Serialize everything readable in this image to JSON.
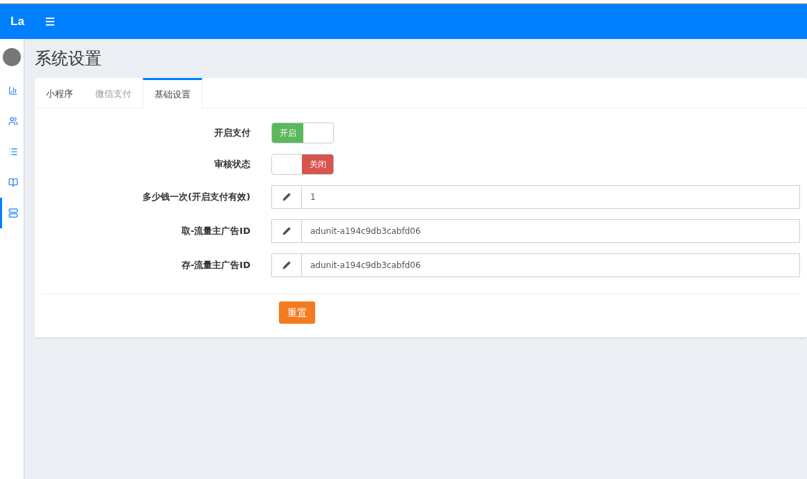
{
  "header": {
    "logo": "La"
  },
  "sidebar": {
    "items": [
      {
        "kind": "chart",
        "selected": false
      },
      {
        "kind": "users",
        "selected": false
      },
      {
        "kind": "list",
        "selected": false
      },
      {
        "kind": "book",
        "selected": false
      },
      {
        "kind": "server",
        "selected": true
      }
    ]
  },
  "page_title": "系统设置",
  "tabs": [
    {
      "label": "小程序",
      "selected": false,
      "disabled": false
    },
    {
      "label": "微信支付",
      "selected": false,
      "disabled": true
    },
    {
      "label": "基础设置",
      "selected": true,
      "disabled": false
    }
  ],
  "fields": [
    {
      "kind": "switch",
      "label": "开启支付",
      "on": true,
      "text": "开启"
    },
    {
      "kind": "switch",
      "label": "审核状态",
      "on": false,
      "text": "关闭"
    },
    {
      "kind": "input",
      "label": "多少钱一次(开启支付有效)",
      "value": "1"
    },
    {
      "kind": "input",
      "label": "取-流量主广告ID",
      "value": "adunit-a194c9db3cabfd06"
    },
    {
      "kind": "input",
      "label": "存-流量主广告ID",
      "value": "adunit-a194c9db3cabfd06"
    }
  ],
  "reset_button": "重置"
}
